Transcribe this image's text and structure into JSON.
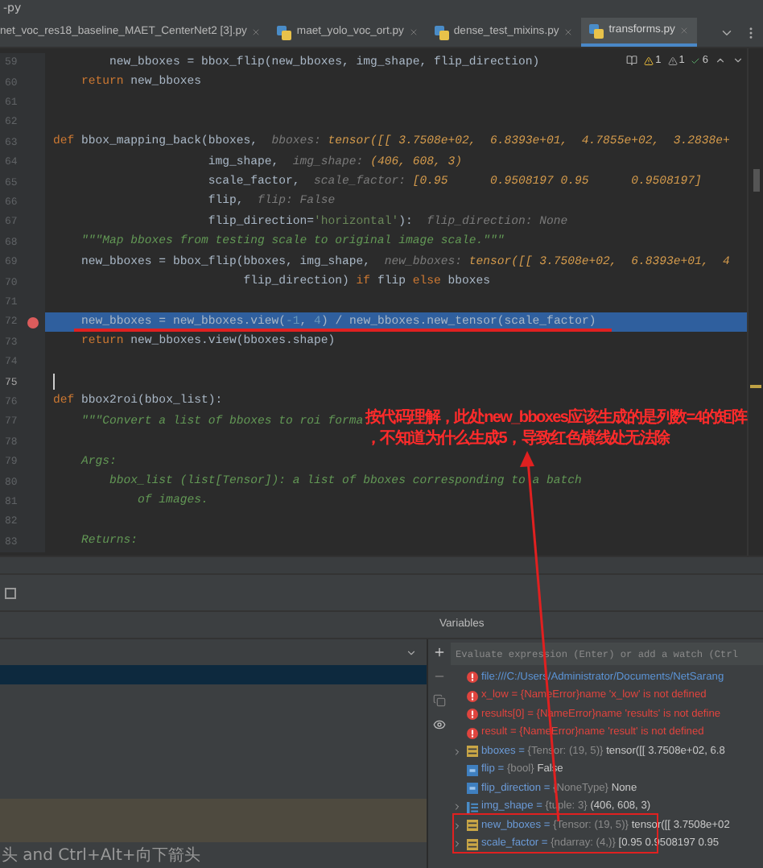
{
  "title": "-py",
  "tabs": [
    {
      "label": "net_voc_res18_baseline_MAET_CenterNet2 [3].py",
      "selected": false
    },
    {
      "label": "maet_yolo_voc_ort.py",
      "selected": false
    },
    {
      "label": "dense_test_mixins.py",
      "selected": false
    },
    {
      "label": "transforms.py",
      "selected": true
    }
  ],
  "inspections": {
    "warnings": "1",
    "weak_warnings": "1",
    "passed": "6"
  },
  "code_lines": [
    {
      "number": "59",
      "breakpoint": false,
      "highlighted": false,
      "caret": false,
      "tokens": [
        {
          "text": "        new_bboxes = bbox_flip(new_bboxes, img_shape, flip_direction)",
          "kind": "plain"
        }
      ]
    },
    {
      "number": "60",
      "breakpoint": false,
      "highlighted": false,
      "caret": false,
      "tokens": [
        {
          "text": "    return",
          "kind": "keyword"
        },
        {
          "text": " new_bboxes",
          "kind": "plain"
        }
      ]
    },
    {
      "number": "61",
      "breakpoint": false,
      "highlighted": false,
      "caret": false
    },
    {
      "number": "62",
      "breakpoint": false,
      "highlighted": false,
      "caret": false
    },
    {
      "number": "63",
      "breakpoint": false,
      "highlighted": false,
      "caret": false,
      "tokens": [
        {
          "text": "def",
          "kind": "keyword"
        },
        {
          "text": " bbox_mapping_back(bboxes,  ",
          "kind": "plain"
        },
        {
          "text": "bboxes: ",
          "kind": "hint"
        },
        {
          "text": "tensor([[ 3.7508e+02,  6.8393e+01,  4.7855e+02,  3.2838e+",
          "kind": "value"
        }
      ]
    },
    {
      "number": "64",
      "breakpoint": false,
      "highlighted": false,
      "caret": false,
      "tokens": [
        {
          "text": "                      img_shape,  ",
          "kind": "plain"
        },
        {
          "text": "img_shape: ",
          "kind": "hint"
        },
        {
          "text": "(406, 608, 3)",
          "kind": "value"
        }
      ]
    },
    {
      "number": "65",
      "breakpoint": false,
      "highlighted": false,
      "caret": false,
      "tokens": [
        {
          "text": "                      scale_factor,  ",
          "kind": "plain"
        },
        {
          "text": "scale_factor: ",
          "kind": "hint"
        },
        {
          "text": "[0.95      0.9508197 0.95      0.9508197]",
          "kind": "value"
        }
      ]
    },
    {
      "number": "66",
      "breakpoint": false,
      "highlighted": false,
      "caret": false,
      "tokens": [
        {
          "text": "                      flip,  ",
          "kind": "plain"
        },
        {
          "text": "flip: False",
          "kind": "hint"
        }
      ]
    },
    {
      "number": "67",
      "breakpoint": false,
      "highlighted": false,
      "caret": false,
      "tokens": [
        {
          "text": "                      flip_direction=",
          "kind": "plain"
        },
        {
          "text": "'horizontal'",
          "kind": "string"
        },
        {
          "text": "):  ",
          "kind": "plain"
        },
        {
          "text": "flip_direction: None",
          "kind": "hint"
        }
      ]
    },
    {
      "number": "68",
      "breakpoint": false,
      "highlighted": false,
      "caret": false,
      "tokens": [
        {
          "text": "    \"\"\"Map bboxes from testing scale to original image scale.\"\"\"",
          "kind": "doc"
        }
      ]
    },
    {
      "number": "69",
      "breakpoint": false,
      "highlighted": false,
      "caret": false,
      "tokens": [
        {
          "text": "    new_bboxes = bbox_flip(bboxes, img_shape,  ",
          "kind": "plain"
        },
        {
          "text": "new_bboxes: ",
          "kind": "hint"
        },
        {
          "text": "tensor([[ 3.7508e+02,  6.8393e+01,  4",
          "kind": "value"
        }
      ]
    },
    {
      "number": "70",
      "breakpoint": false,
      "highlighted": false,
      "caret": false,
      "tokens": [
        {
          "text": "                           flip_direction) ",
          "kind": "plain"
        },
        {
          "text": "if",
          "kind": "keyword"
        },
        {
          "text": " flip ",
          "kind": "plain"
        },
        {
          "text": "else",
          "kind": "keyword"
        },
        {
          "text": " bboxes",
          "kind": "plain"
        }
      ]
    },
    {
      "number": "71",
      "breakpoint": false,
      "highlighted": false,
      "caret": false
    },
    {
      "number": "72",
      "breakpoint": true,
      "highlighted": true,
      "caret": false,
      "tokens": [
        {
          "text": "    new_bboxes = new_bboxes.view(",
          "kind": "plain"
        },
        {
          "text": "-1",
          "kind": "number"
        },
        {
          "text": ", ",
          "kind": "plain"
        },
        {
          "text": "4",
          "kind": "number"
        },
        {
          "text": ") / new_bboxes.new_tensor(scale_factor)",
          "kind": "plain"
        }
      ]
    },
    {
      "number": "73",
      "breakpoint": false,
      "highlighted": false,
      "caret": false,
      "tokens": [
        {
          "text": "    return",
          "kind": "keyword"
        },
        {
          "text": " new_bboxes.view(bboxes.shape)",
          "kind": "plain"
        }
      ]
    },
    {
      "number": "74",
      "breakpoint": false,
      "highlighted": false,
      "caret": false
    },
    {
      "number": "75",
      "breakpoint": false,
      "highlighted": false,
      "caret": true
    },
    {
      "number": "76",
      "breakpoint": false,
      "highlighted": false,
      "caret": false,
      "tokens": [
        {
          "text": "def",
          "kind": "keyword"
        },
        {
          "text": " bbox2roi(bbox_list):",
          "kind": "plain"
        }
      ]
    },
    {
      "number": "77",
      "breakpoint": false,
      "highlighted": false,
      "caret": false,
      "tokens": [
        {
          "text": "    \"\"\"Convert a list of bboxes to roi forma",
          "kind": "doc"
        }
      ]
    },
    {
      "number": "78",
      "breakpoint": false,
      "highlighted": false,
      "caret": false
    },
    {
      "number": "79",
      "breakpoint": false,
      "highlighted": false,
      "caret": false,
      "tokens": [
        {
          "text": "    Args:",
          "kind": "doc"
        }
      ]
    },
    {
      "number": "80",
      "breakpoint": false,
      "highlighted": false,
      "caret": false,
      "tokens": [
        {
          "text": "        bbox_list (list[Tensor]): a list of bboxes corresponding to a batch",
          "kind": "doc"
        }
      ]
    },
    {
      "number": "81",
      "breakpoint": false,
      "highlighted": false,
      "caret": false,
      "tokens": [
        {
          "text": "            of images.",
          "kind": "doc"
        }
      ]
    },
    {
      "number": "82",
      "breakpoint": false,
      "highlighted": false,
      "caret": false
    },
    {
      "number": "83",
      "breakpoint": false,
      "highlighted": false,
      "caret": false,
      "tokens": [
        {
          "text": "    Returns:",
          "kind": "doc"
        }
      ]
    }
  ],
  "annotation": {
    "lines": [
      "按代码理解，此处new_bboxes应该生成的是列数=4的矩阵",
      "，不知道为什么生成5，导致红色横线处无法除"
    ]
  },
  "variables": {
    "title": "Variables",
    "evaluate": {
      "placeholder": "Evaluate expression (Enter) or add a watch (Ctrl"
    },
    "items": [
      {
        "kind": "link",
        "expandable": false,
        "text": "file:///C:/Users/Administrator/Documents/NetSarang"
      },
      {
        "kind": "error",
        "expandable": false,
        "text": "x_low = {NameError}name 'x_low' is not defined"
      },
      {
        "kind": "error",
        "expandable": false,
        "text": "results[0] = {NameError}name 'results' is not define"
      },
      {
        "kind": "error",
        "expandable": false,
        "text": "result = {NameError}name 'result' is not defined"
      },
      {
        "kind": "tensor",
        "expandable": true,
        "name": "bboxes =",
        "type": "{Tensor: (19, 5)}",
        "value": "tensor([[ 3.7508e+02,  6.8"
      },
      {
        "kind": "scalar",
        "expandable": false,
        "name": "flip =",
        "type": "{bool}",
        "value": "False"
      },
      {
        "kind": "scalar",
        "expandable": false,
        "name": "flip_direction =",
        "type": "{NoneType}",
        "value": "None"
      },
      {
        "kind": "sequence",
        "expandable": true,
        "name": "img_shape =",
        "type": "{tuple: 3}",
        "value": "(406, 608, 3)"
      },
      {
        "kind": "tensor",
        "expandable": true,
        "name": "new_bboxes =",
        "type": "{Tensor: (19, 5)}",
        "value": "tensor([[ 3.7508e+02"
      },
      {
        "kind": "tensor",
        "expandable": true,
        "name": "scale_factor =",
        "type": "{ndarray: (4,)}",
        "value": "[0.95      0.9508197 0.95"
      }
    ]
  },
  "status": "头 and Ctrl+Alt+向下箭头"
}
